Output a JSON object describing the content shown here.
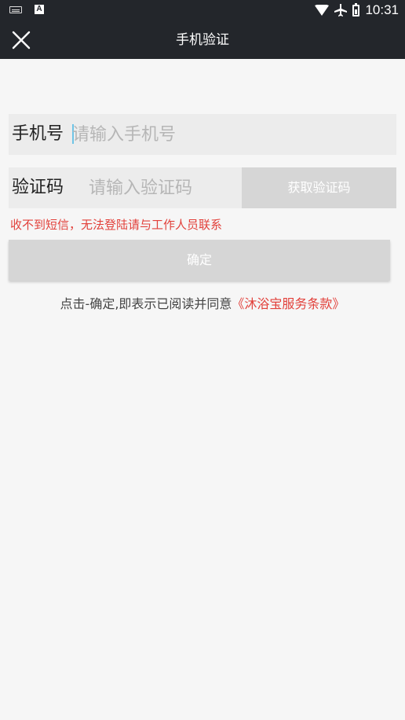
{
  "status_bar": {
    "time": "10:31",
    "icons": [
      "keyboard-icon",
      "a-notification-icon",
      "wifi-icon",
      "airplane-icon",
      "battery-icon"
    ],
    "a_icon_text": "A"
  },
  "toolbar": {
    "title": "手机验证",
    "close_icon": "close-icon"
  },
  "form": {
    "phone_label": "手机号",
    "phone_placeholder": "请输入手机号",
    "phone_value": "",
    "code_label": "验证码",
    "code_placeholder": "请输入验证码",
    "code_value": "",
    "get_code_label": "获取验证码",
    "warning_text": "收不到短信，无法登陆请与工作人员联系",
    "confirm_label": "确定"
  },
  "agreement": {
    "prefix": "点击-确定,即表示已阅读并同意",
    "link_text": "《沐浴宝服务条款》"
  },
  "colors": {
    "toolbar_bg": "#23262b",
    "page_bg": "#f6f6f6",
    "field_bg": "#ececec",
    "button_disabled_bg": "#d6d6d6",
    "accent_red": "#e2413b",
    "cursor_blue": "#6ec4e6"
  }
}
